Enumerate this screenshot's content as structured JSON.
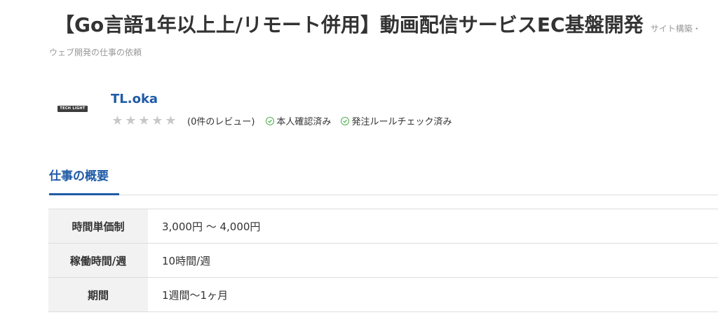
{
  "job": {
    "title": "【Go言語1年以上上/リモート併用】動画配信サービスEC基盤開発",
    "category_part1": "サイト構築・",
    "category_part2": "ウェブ開発の仕事の依頼"
  },
  "client": {
    "logo_text": "TECH LIGHT",
    "name": "TL.oka",
    "rating_stars": 0,
    "rating_max": 5,
    "reviews_text": "(0件のレビュー)",
    "badges": [
      {
        "label": "本人確認済み",
        "icon": "check-circle-icon"
      },
      {
        "label": "発注ルールチェック済み",
        "icon": "check-circle-icon"
      }
    ]
  },
  "tabs": [
    {
      "label": "仕事の概要",
      "active": true
    }
  ],
  "summary": {
    "rows": [
      {
        "label": "時間単価制",
        "value": "3,000円 〜 4,000円"
      },
      {
        "label": "稼働時間/週",
        "value": "10時間/週"
      },
      {
        "label": "期間",
        "value": "1週間〜1ヶ月"
      }
    ]
  },
  "colors": {
    "link": "#1f5aa6",
    "check": "#4cae4c",
    "star_empty": "#c8c8c8"
  }
}
